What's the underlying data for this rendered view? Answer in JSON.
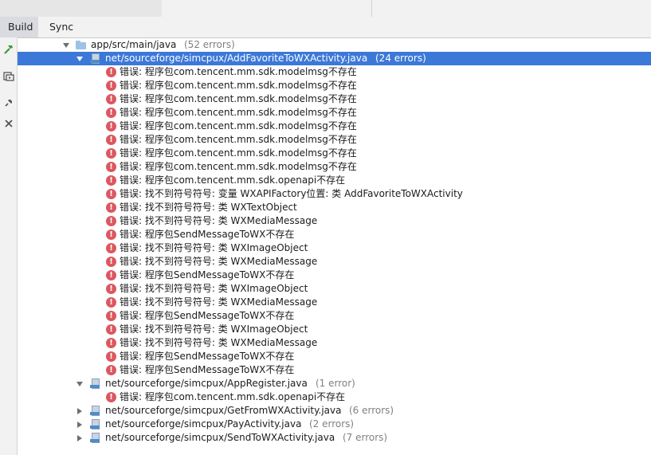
{
  "tabs": [
    {
      "label": "Build",
      "active": true
    },
    {
      "label": "Sync",
      "active": false
    }
  ],
  "left_toolbar": [
    "hammer-icon",
    "layout-icon",
    "pin-icon",
    "close-icon"
  ],
  "tree": {
    "root": {
      "label": "app/src/main/java",
      "count": "(52 errors)"
    },
    "files": [
      {
        "label": "net/sourceforge/simcpux/AddFavoriteToWXActivity.java",
        "count": "(24 errors)",
        "expanded": true,
        "selected": true,
        "errors": [
          "错误: 程序包com.tencent.mm.sdk.modelmsg不存在",
          "错误: 程序包com.tencent.mm.sdk.modelmsg不存在",
          "错误: 程序包com.tencent.mm.sdk.modelmsg不存在",
          "错误: 程序包com.tencent.mm.sdk.modelmsg不存在",
          "错误: 程序包com.tencent.mm.sdk.modelmsg不存在",
          "错误: 程序包com.tencent.mm.sdk.modelmsg不存在",
          "错误: 程序包com.tencent.mm.sdk.modelmsg不存在",
          "错误: 程序包com.tencent.mm.sdk.modelmsg不存在",
          "错误: 程序包com.tencent.mm.sdk.openapi不存在",
          "错误: 找不到符号符号:   变量 WXAPIFactory位置: 类 AddFavoriteToWXActivity",
          "错误: 找不到符号符号: 类 WXTextObject",
          "错误: 找不到符号符号: 类 WXMediaMessage",
          "错误: 程序包SendMessageToWX不存在",
          "错误: 找不到符号符号: 类 WXImageObject",
          "错误: 找不到符号符号: 类 WXMediaMessage",
          "错误: 程序包SendMessageToWX不存在",
          "错误: 找不到符号符号: 类 WXImageObject",
          "错误: 找不到符号符号: 类 WXMediaMessage",
          "错误: 程序包SendMessageToWX不存在",
          "错误: 找不到符号符号: 类 WXImageObject",
          "错误: 找不到符号符号: 类 WXMediaMessage",
          "错误: 程序包SendMessageToWX不存在",
          "错误: 程序包SendMessageToWX不存在"
        ]
      },
      {
        "label": "net/sourceforge/simcpux/AppRegister.java",
        "count": "(1 error)",
        "expanded": true,
        "selected": false,
        "errors": [
          "错误: 程序包com.tencent.mm.sdk.openapi不存在"
        ]
      },
      {
        "label": "net/sourceforge/simcpux/GetFromWXActivity.java",
        "count": "(6 errors)",
        "expanded": false,
        "selected": false,
        "errors": []
      },
      {
        "label": "net/sourceforge/simcpux/PayActivity.java",
        "count": "(2 errors)",
        "expanded": false,
        "selected": false,
        "errors": []
      },
      {
        "label": "net/sourceforge/simcpux/SendToWXActivity.java",
        "count": "(7 errors)",
        "expanded": false,
        "selected": false,
        "errors": []
      }
    ]
  },
  "colors": {
    "selection": "#3c78d8",
    "error": "#db5860",
    "folder": "#9cc2e6"
  }
}
